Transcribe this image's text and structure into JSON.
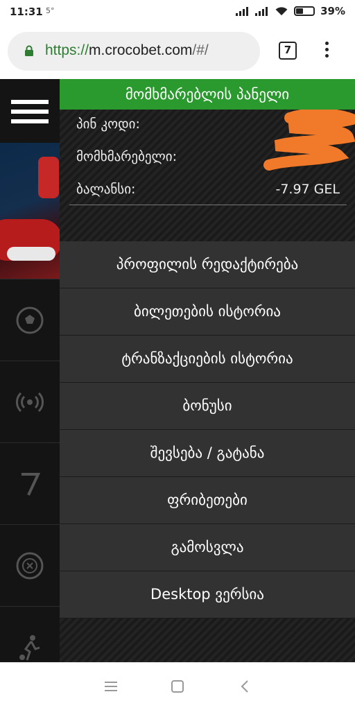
{
  "status_bar": {
    "time": "11:31",
    "temperature": "5°",
    "battery": "39%"
  },
  "browser": {
    "url_scheme": "https://",
    "url_host": "m.crocobet.com",
    "url_path": "/#/",
    "tab_count": "7"
  },
  "side_nav": {
    "icons": [
      "soccer-ball-icon",
      "live-broadcast-icon",
      "slot-seven-icon",
      "roulette-icon",
      "football-player-icon"
    ]
  },
  "user_panel": {
    "title": "მომხმარებლის პანელი",
    "rows": [
      {
        "label": "პინ კოდი:",
        "value": ""
      },
      {
        "label": "მომხმარებელი:",
        "value": ""
      },
      {
        "label": "ბალანსი:",
        "value": "-7.97 GEL"
      }
    ]
  },
  "menu": {
    "items": [
      "პროფილის რედაქტირება",
      "ბილეთების ისტორია",
      "ტრანზაქციების ისტორია",
      "ბონუსი",
      "შევსება / გატანა",
      "ფრიბეთები",
      "გამოსვლა",
      "Desktop ვერსია"
    ]
  },
  "colors": {
    "accent_green": "#2a9a2e",
    "menu_bg": "#323232",
    "redaction_orange": "#f07a2a"
  }
}
